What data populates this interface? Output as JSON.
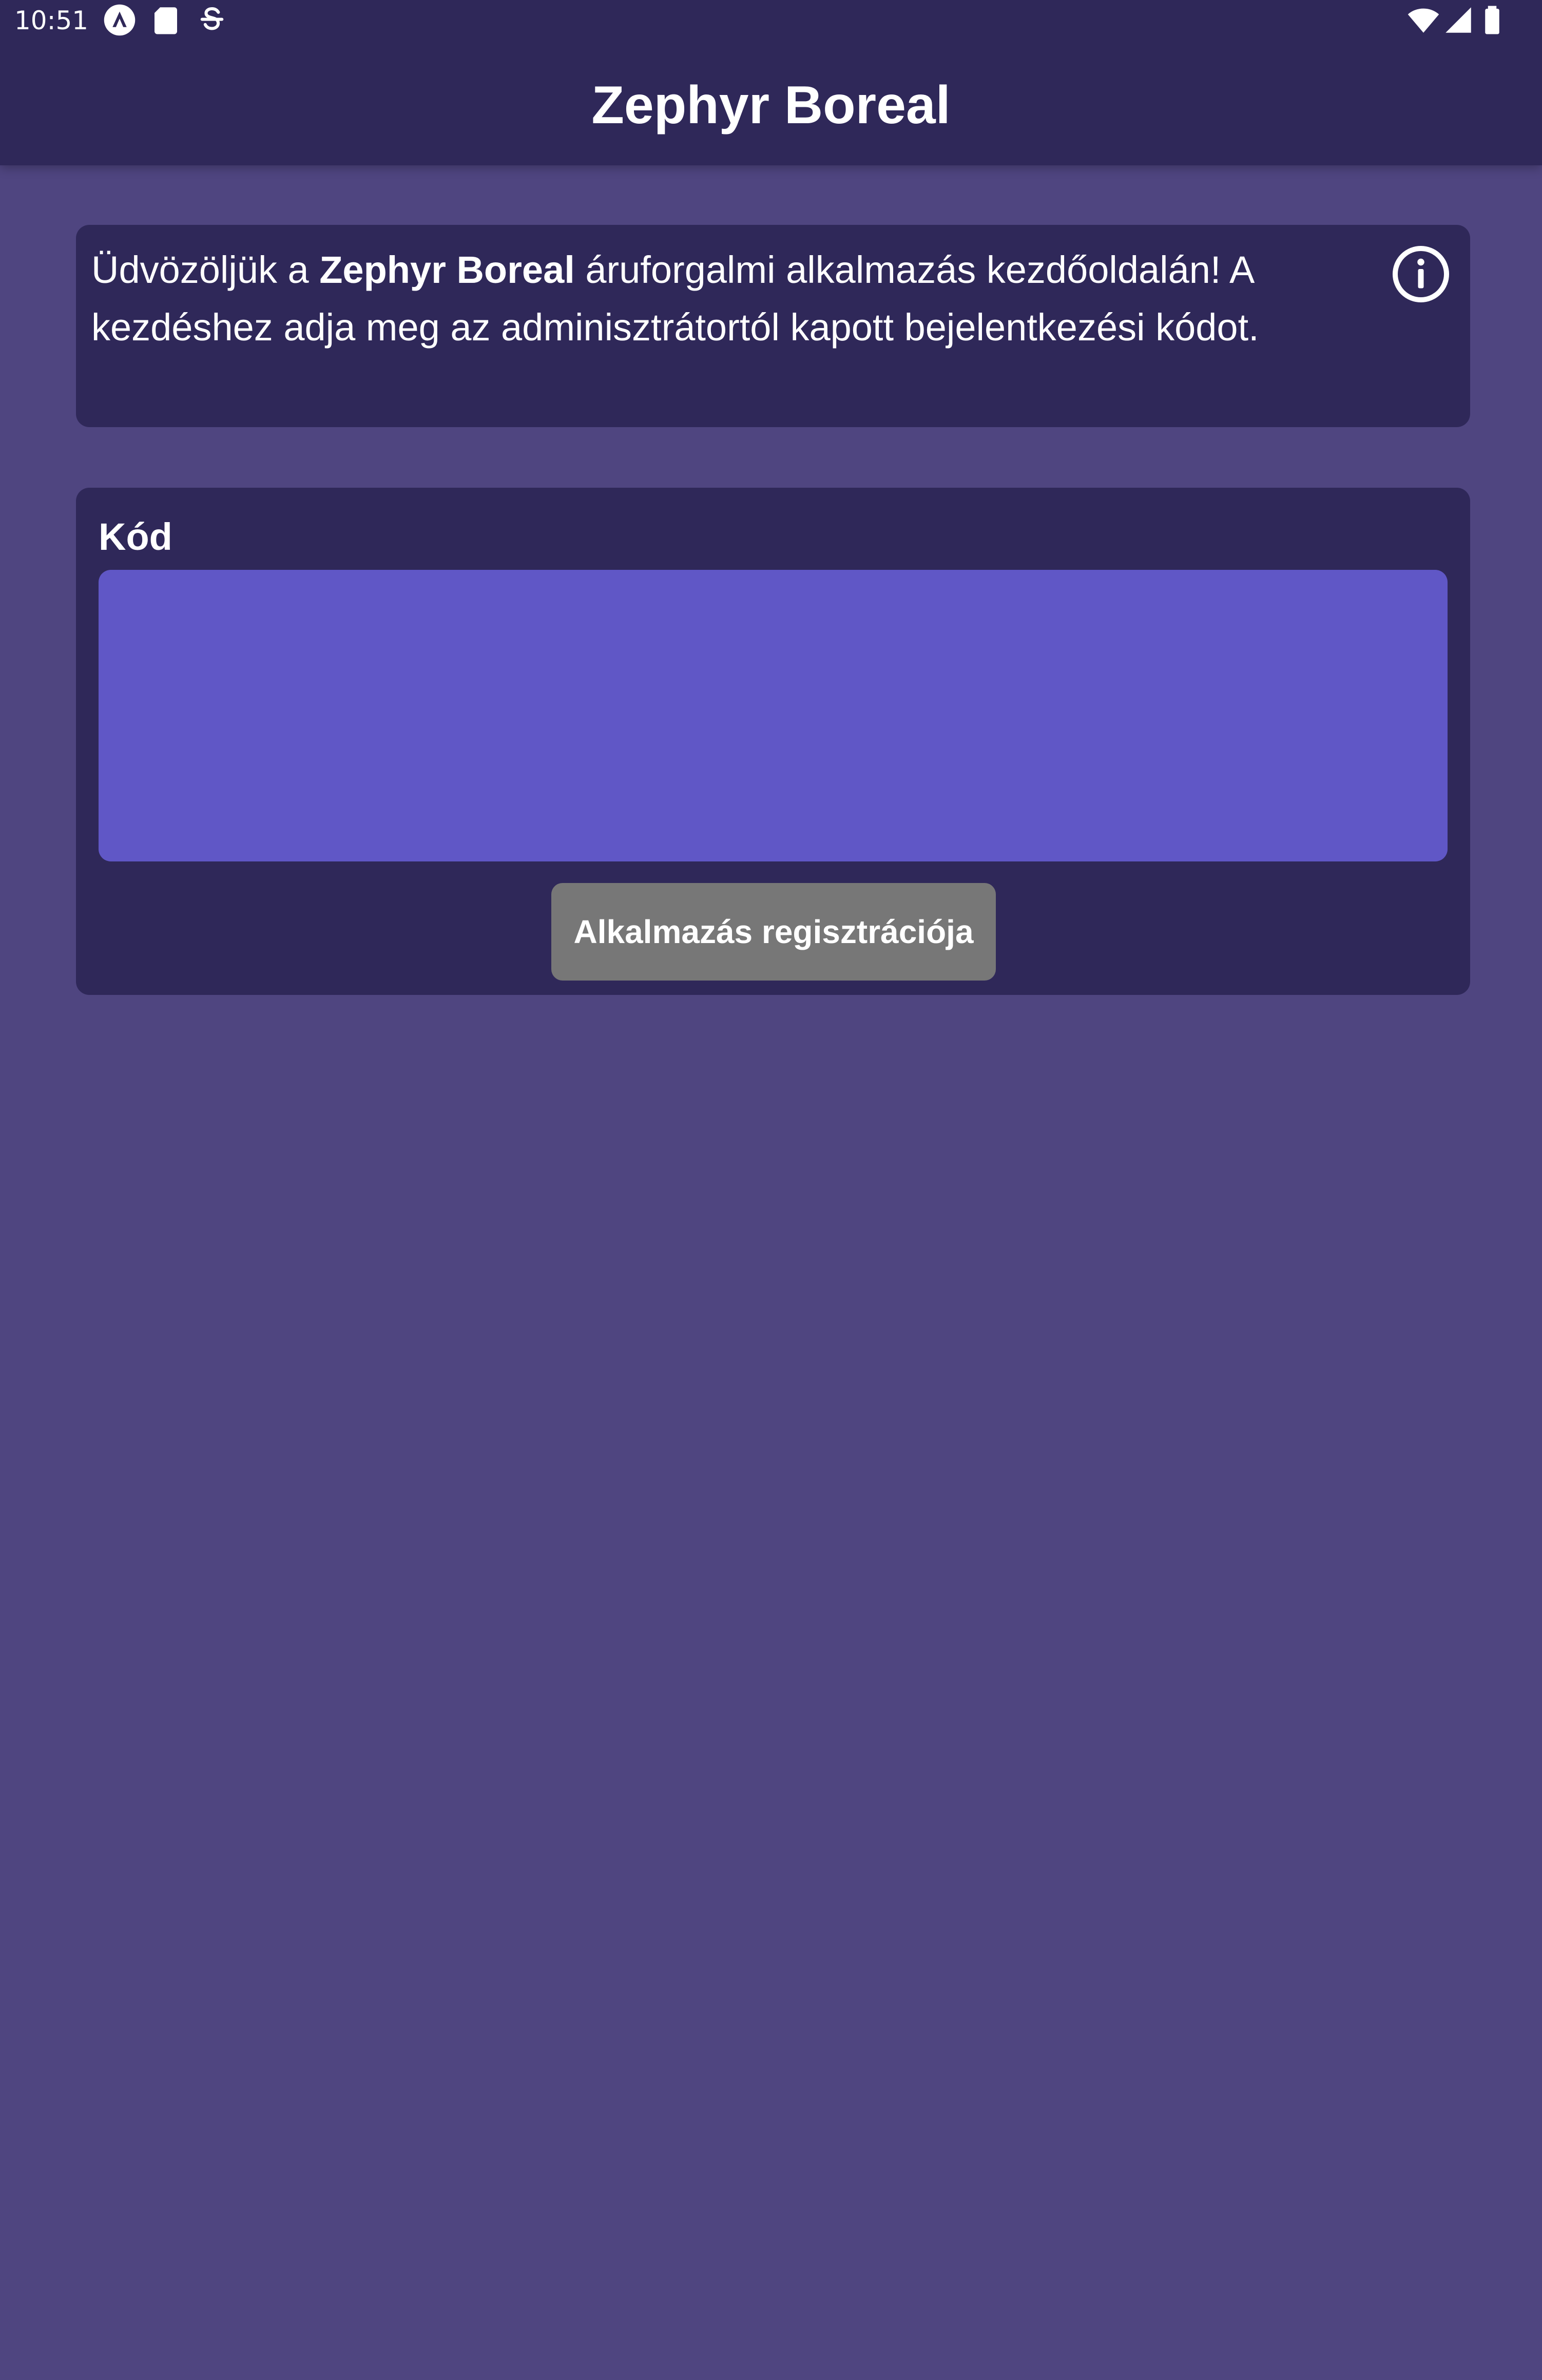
{
  "status_bar": {
    "time": "10:51",
    "left_icons": [
      "app-a-icon",
      "sd-card-icon",
      "sync-s-icon"
    ],
    "right_icons": [
      "wifi-icon",
      "cell-signal-icon",
      "battery-icon"
    ]
  },
  "header": {
    "title": "Zephyr Boreal"
  },
  "welcome": {
    "text_before": "Üdvözöljük a ",
    "brand": "Zephyr Boreal",
    "text_after": " áruforgalmi alkalmazás kezdőoldalán! A kezdéshez adja meg az adminisztrátortól kapott bejelentkezési kódot.",
    "info_icon": "info-icon"
  },
  "code_form": {
    "label": "Kód",
    "value": "",
    "placeholder": "",
    "register_button_label": "Alkalmazás regisztrációja"
  },
  "colors": {
    "background": "#4f4580",
    "bar_and_cards": "#2f2859",
    "input_fill": "#6057c6",
    "button_disabled": "#777777",
    "text": "#ffffff"
  }
}
